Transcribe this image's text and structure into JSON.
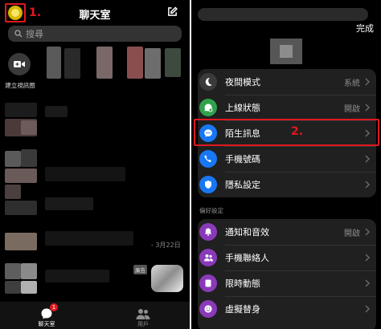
{
  "left_panel": {
    "title": "聊天室",
    "search_placeholder": "搜尋",
    "create_video_label": "建立視訊圈",
    "step1_label": "1.",
    "last_date": "- 3月22日",
    "ad_label": "廣告",
    "tabs": [
      {
        "label": "聊天室",
        "icon": "chat-icon",
        "badge": "1"
      },
      {
        "label": "用戶",
        "icon": "people-icon"
      }
    ]
  },
  "right_panel": {
    "done_label": "完成",
    "step2_label": "2.",
    "groups": [
      {
        "items": [
          {
            "label": "夜間模式",
            "value": "系統",
            "icon": "moon-icon",
            "color": "#3a3a3a"
          },
          {
            "label": "上線狀態",
            "value": "開啟",
            "icon": "online-status-icon",
            "color": "#31a24c"
          },
          {
            "label": "陌生訊息",
            "value": "",
            "icon": "message-bubble-icon",
            "color": "#1877f2"
          },
          {
            "label": "手機號碼",
            "value": "",
            "icon": "phone-icon",
            "color": "#1877f2"
          },
          {
            "label": "隱私設定",
            "value": "",
            "icon": "shield-icon",
            "color": "#1877f2"
          }
        ]
      },
      {
        "title": "偏好設定",
        "items": [
          {
            "label": "通知和音效",
            "value": "開啟",
            "icon": "bell-icon",
            "color": "#8a3ab9"
          },
          {
            "label": "手機聯絡人",
            "value": "",
            "icon": "contacts-icon",
            "color": "#8a3ab9"
          },
          {
            "label": "限時動態",
            "value": "",
            "icon": "stories-icon",
            "color": "#8a3ab9"
          },
          {
            "label": "虛擬替身",
            "value": "",
            "icon": "avatar-icon",
            "color": "#8a3ab9"
          }
        ]
      }
    ]
  },
  "colors": {
    "highlight": "#e0191f",
    "background": "#000000",
    "card": "#202020"
  }
}
